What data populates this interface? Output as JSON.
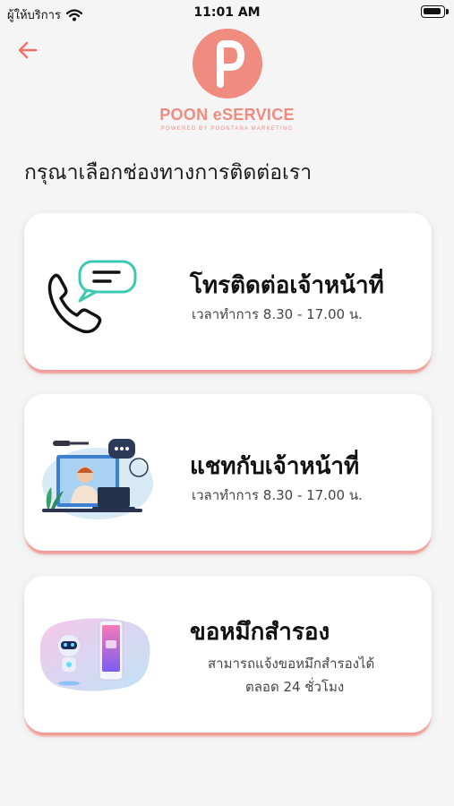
{
  "status_bar": {
    "carrier": "ผู้ให้บริการ",
    "time": "11:01 AM"
  },
  "header": {
    "back_icon": "arrow-left-icon",
    "logo_title": "POON eSERVICE",
    "logo_subtitle": "POWERED BY POONTANA MARKETING"
  },
  "page": {
    "title": "กรุณาเลือกช่องทางการติดต่อเรา"
  },
  "colors": {
    "brand": "#f08b80",
    "card_shadow": "#f29b96",
    "accent_teal": "#3cc9b4"
  },
  "options": [
    {
      "title": "โทรติดต่อเจ้าหน้าที่",
      "subtitle": "เวลาทำการ 8.30 - 17.00 น.",
      "icon": "phone-chat-icon"
    },
    {
      "title": "แชทกับเจ้าหน้าที่",
      "subtitle": "เวลาทำการ 8.30 - 17.00 น.",
      "icon": "agent-chat-illustration"
    },
    {
      "title": "ขอหมึกสำรอง",
      "subtitle_line1": "สามารถแจ้งขอหมึกสำรองได้",
      "subtitle_line2": "ตลอด 24 ชั่วโมง",
      "icon": "robot-phone-illustration"
    }
  ]
}
